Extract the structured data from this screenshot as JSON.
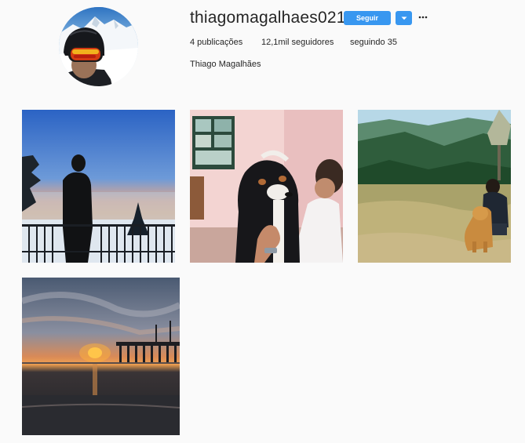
{
  "profile": {
    "username": "thiagomagalhaes021",
    "full_name": "Thiago Magalhães",
    "avatar_icon": "profile-photo-skier-icon",
    "stats": {
      "posts": "4 publicações",
      "followers": "12,1mil seguidores",
      "following": "seguindo 35"
    }
  },
  "actions": {
    "follow_label": "Seguir",
    "dropdown_icon": "chevron-down-icon",
    "options_icon": "more-options-icon",
    "accent_color": "#3897f0"
  },
  "posts": [
    {
      "name": "post-silhouette-sunset",
      "icon": "photo-man-silhouette-sunset"
    },
    {
      "name": "post-bernese-dog",
      "icon": "photo-bernese-mountain-dog"
    },
    {
      "name": "post-golden-retriever-field",
      "icon": "photo-golden-retriever-mountains"
    },
    {
      "name": "post-pier-sunset",
      "icon": "photo-pier-sunset-beach"
    }
  ]
}
